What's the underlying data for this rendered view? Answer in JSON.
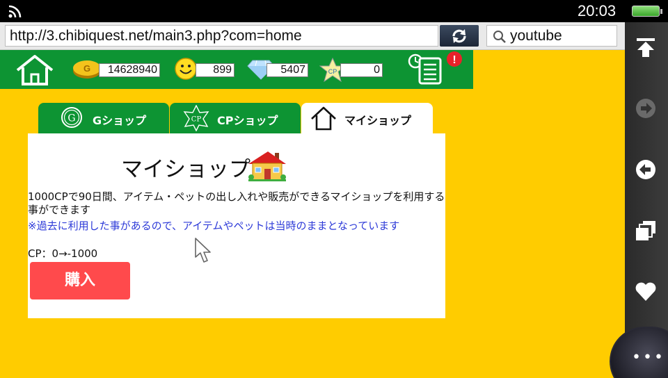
{
  "status_bar": {
    "time": "20:03",
    "wifi_icon": "wifi-icon",
    "battery_icon": "battery-icon"
  },
  "browser": {
    "url": "http://3.chibiquest.net/main3.php?com=home",
    "reload_icon": "reload-icon",
    "search": {
      "value": "youtube",
      "icon": "search-icon"
    }
  },
  "sidebar": {
    "items": [
      {
        "name": "scroll-top",
        "icon": "scroll-top-icon"
      },
      {
        "name": "forward",
        "icon": "forward-icon"
      },
      {
        "name": "back",
        "icon": "back-icon"
      },
      {
        "name": "windows",
        "icon": "windows-icon"
      },
      {
        "name": "bookmarks",
        "icon": "heart-icon"
      }
    ],
    "more_icon": "more-icon"
  },
  "game_header": {
    "home_icon": "home-icon",
    "gold": "14628940",
    "smile": "899",
    "diamond": "5407",
    "cp": "0",
    "gold_coin_letter": "G",
    "cp_star_letter": "CP",
    "log_icon": "log-icon",
    "alert_mark": "!"
  },
  "tabs": [
    {
      "label": "Gショップ",
      "icon_letter": "G",
      "active": false
    },
    {
      "label": "CPショップ",
      "icon_letter": "CP",
      "active": false
    },
    {
      "label": "マイショップ",
      "active": true
    }
  ],
  "panel": {
    "title": "マイショップ",
    "description": "1000CPで90日間、アイテム・ペットの出し入れや販売ができるマイショップを利用する事ができます",
    "notice": "※過去に利用した事があるので、アイテムやペットは当時のままとなっています",
    "cp_change": "CP：0→-1000",
    "buy_label": "購入"
  },
  "colors": {
    "background": "#ffcc00",
    "header_green": "#0d9433",
    "buy_red": "#ff4a4c",
    "notice_blue": "#2d3ad8"
  }
}
